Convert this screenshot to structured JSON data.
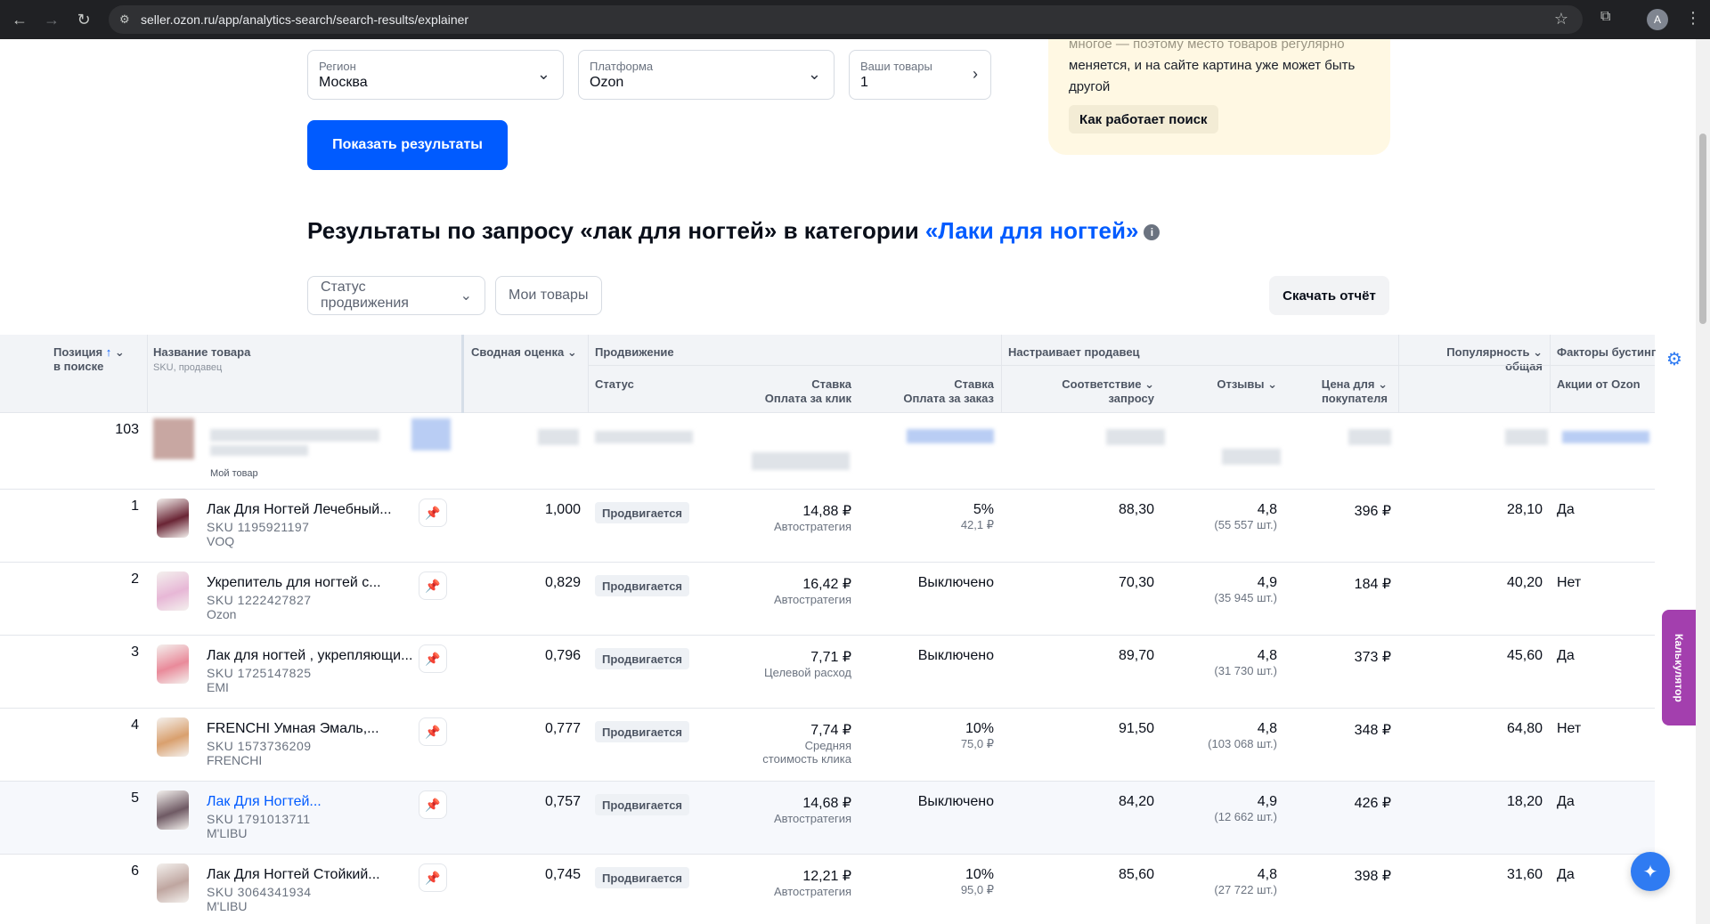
{
  "browser": {
    "url": "seller.ozon.ru/app/analytics-search/search-results/explainer",
    "avatar": "A"
  },
  "filters": {
    "region": {
      "label": "Регион",
      "value": "Москва"
    },
    "platform": {
      "label": "Платформа",
      "value": "Ozon"
    },
    "my_goods": {
      "label": "Ваши товары",
      "value": "1"
    },
    "show_button": "Показать результаты"
  },
  "info_card": {
    "text_top": "многое — поэтому место товаров регулярно",
    "text_mid": "меняется, и на сайте картина уже может быть",
    "text_bot": "другой",
    "button": "Как работает поиск"
  },
  "heading": {
    "prefix": "Результаты по запросу «лак для ногтей» в категории ",
    "category": "«Лаки для ногтей»"
  },
  "toolbar": {
    "status_filter": "Статус продвижения",
    "my_goods_filter": "Мои товары",
    "download": "Скачать отчёт"
  },
  "table": {
    "headers": {
      "position": "Позиция",
      "position2": "в поиске",
      "name": "Название товара",
      "name_sub": "SKU, продавец",
      "score": "Сводная оценка",
      "promotion": "Продвижение",
      "status": "Статус",
      "bid_click": "Ставка",
      "bid_click2": "Оплата за клик",
      "bid_order": "Ставка",
      "bid_order2": "Оплата за заказ",
      "seller_config": "Настраивает продавец",
      "relevance": "Соответствие",
      "relevance2": "запросу",
      "reviews": "Отзывы",
      "price": "Цена для",
      "price2": "покупателя",
      "popularity": "Популярность",
      "popularity2": "общая",
      "boost": "Факторы бустинг",
      "promo": "Акции от Ozon"
    },
    "my_row": {
      "position": "103",
      "tag": "Мой товар"
    },
    "rows": [
      {
        "pos": "1",
        "name": "Лак Для Ногтей Лечебный...",
        "sku": "SKU 1195921197",
        "seller": "VOQ",
        "score": "1,000",
        "status": "Продвигается",
        "click": "14,88 ₽",
        "click_sub": "Автостратегия",
        "click_sub2": "",
        "order": "5%",
        "order_sub": "42,1 ₽",
        "relevance": "88,30",
        "rating": "4,8",
        "reviews": "(55 557 шт.)",
        "price": "396 ₽",
        "popularity": "28,10",
        "promo": "Да",
        "link": false,
        "img": "#6a2535"
      },
      {
        "pos": "2",
        "name": "Укрепитель для ногтей с...",
        "sku": "SKU 1222427827",
        "seller": "Ozon",
        "score": "0,829",
        "status": "Продвигается",
        "click": "16,42 ₽",
        "click_sub": "Автостратегия",
        "click_sub2": "",
        "order": "Выключено",
        "order_sub": "",
        "relevance": "70,30",
        "rating": "4,9",
        "reviews": "(35 945 шт.)",
        "price": "184 ₽",
        "popularity": "40,20",
        "promo": "Нет",
        "link": false,
        "img": "#e7b7d6"
      },
      {
        "pos": "3",
        "name": "Лак для ногтей , укрепляющи...",
        "sku": "SKU 1725147825",
        "seller": "EMI",
        "score": "0,796",
        "status": "Продвигается",
        "click": "7,71 ₽",
        "click_sub": "Целевой расход",
        "click_sub2": "",
        "order": "Выключено",
        "order_sub": "",
        "relevance": "89,70",
        "rating": "4,8",
        "reviews": "(31 730 шт.)",
        "price": "373 ₽",
        "popularity": "45,60",
        "promo": "Да",
        "link": false,
        "img": "#e98a9a"
      },
      {
        "pos": "4",
        "name": "FRENCHI Умная Эмаль,...",
        "sku": "SKU 1573736209",
        "seller": "FRENCHI",
        "score": "0,777",
        "status": "Продвигается",
        "click": "7,74 ₽",
        "click_sub": "Средняя",
        "click_sub2": "стоимость клика",
        "order": "10%",
        "order_sub": "75,0 ₽",
        "relevance": "91,50",
        "rating": "4,8",
        "reviews": "(103 068 шт.)",
        "price": "348 ₽",
        "popularity": "64,80",
        "promo": "Нет",
        "link": false,
        "img": "#d9a06e"
      },
      {
        "pos": "5",
        "name": "Лак Для Ногтей...",
        "sku": "SKU 1791013711",
        "seller": "M'LIBU",
        "score": "0,757",
        "status": "Продвигается",
        "click": "14,68 ₽",
        "click_sub": "Автостратегия",
        "click_sub2": "",
        "order": "Выключено",
        "order_sub": "",
        "relevance": "84,20",
        "rating": "4,9",
        "reviews": "(12 662 шт.)",
        "price": "426 ₽",
        "popularity": "18,20",
        "promo": "Да",
        "link": true,
        "img": "#6f5a64"
      },
      {
        "pos": "6",
        "name": "Лак Для Ногтей Стойкий...",
        "sku": "SKU 3064341934",
        "seller": "M'LIBU",
        "score": "0,745",
        "status": "Продвигается",
        "click": "12,21 ₽",
        "click_sub": "Автостратегия",
        "click_sub2": "",
        "order": "10%",
        "order_sub": "95,0 ₽",
        "relevance": "85,60",
        "rating": "4,8",
        "reviews": "(27 722 шт.)",
        "price": "398 ₽",
        "popularity": "31,60",
        "promo": "Да",
        "link": false,
        "img": "#bfa6a0"
      }
    ]
  },
  "side": {
    "calculator": "Калькулятор"
  }
}
